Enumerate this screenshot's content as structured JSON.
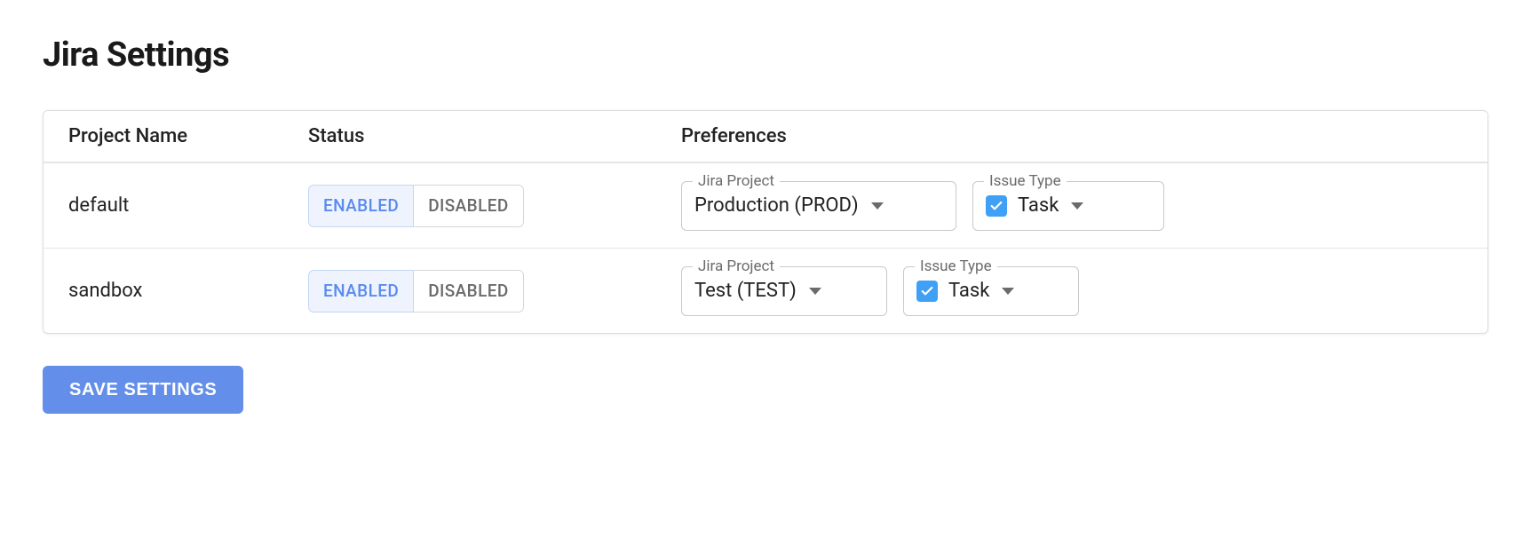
{
  "title": "Jira Settings",
  "columns": {
    "project": "Project Name",
    "status": "Status",
    "preferences": "Preferences"
  },
  "toggle": {
    "enabled": "ENABLED",
    "disabled": "DISABLED"
  },
  "field_labels": {
    "jira_project": "Jira Project",
    "issue_type": "Issue Type"
  },
  "rows": [
    {
      "name": "default",
      "status_active": "enabled",
      "jira_project": "Production (PROD)",
      "issue_type": "Task",
      "issue_checked": true
    },
    {
      "name": "sandbox",
      "status_active": "enabled",
      "jira_project": "Test (TEST)",
      "issue_type": "Task",
      "issue_checked": true
    }
  ],
  "save_label": "SAVE SETTINGS"
}
